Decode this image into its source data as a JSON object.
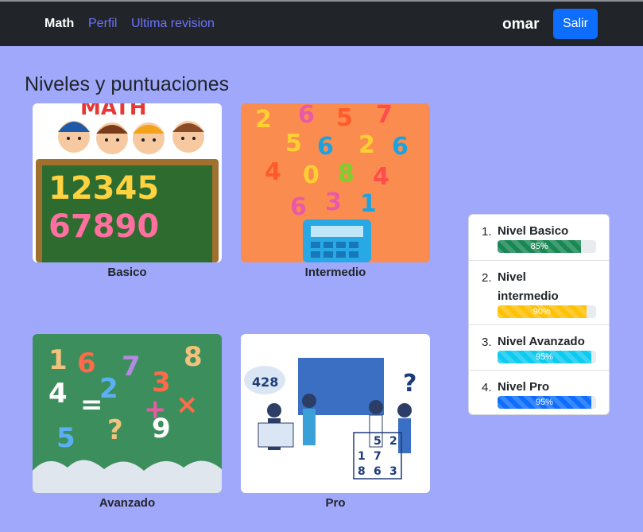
{
  "navbar": {
    "brand": "Math",
    "links": [
      "Perfil",
      "Ultima revision"
    ],
    "user": "omar",
    "logout_label": "Salir"
  },
  "main": {
    "title": "Niveles y puntuaciones",
    "cards": [
      {
        "label": "Basico",
        "image_text": "MATH",
        "digits_row1": "12345",
        "digits_row2": "67890"
      },
      {
        "label": "Intermedio"
      },
      {
        "label": "Avanzado"
      },
      {
        "label": "Pro",
        "sudoku": [
          "5",
          "2",
          "1",
          "7",
          "8",
          "6",
          "3"
        ],
        "bubble": "428"
      }
    ]
  },
  "levels": {
    "items": [
      {
        "number": "1.",
        "label": "Nivel Basico",
        "percent": 85,
        "percent_label": "85%",
        "color": "#198754"
      },
      {
        "number": "2.",
        "label_line1": "Nivel",
        "label_line2": "intermedio",
        "percent": 90,
        "percent_label": "90%",
        "color": "#ffc107"
      },
      {
        "number": "3.",
        "label": "Nivel Avanzado",
        "percent": 95,
        "percent_label": "95%",
        "color": "#0dcaf0"
      },
      {
        "number": "4.",
        "label": "Nivel Pro",
        "percent": 95,
        "percent_label": "95%",
        "color": "#0d6efd"
      }
    ]
  }
}
